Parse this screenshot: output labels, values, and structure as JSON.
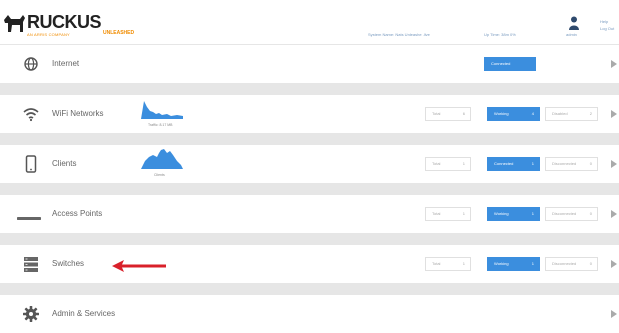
{
  "header": {
    "brand": "RUCKUS",
    "tagline": "AN ARRIS COMPANY",
    "product": "UNLEASHED",
    "system_name_label": "System Name: Nats Unleashe .llve",
    "up_time_label": "Up Time: 38m 0%",
    "user_label": "admin",
    "help_label": "Help",
    "logout_label": "Log Out",
    "icons": {
      "logo": "ruckus-dog-logo",
      "user": "user-icon"
    }
  },
  "colors": {
    "accent_blue": "#3b8ede",
    "brand_orange": "#f08c00",
    "annotation_red": "#d9202a"
  },
  "rows": {
    "internet": {
      "label": "Internet",
      "status": "Connected",
      "icon": "globe-icon"
    },
    "wifi": {
      "label": "WiFi Networks",
      "spark_label": "Traffic: 8.17 MB",
      "icon": "wifi-icon",
      "total_label": "Total",
      "total": "6",
      "working_label": "Working",
      "working": "4",
      "disabled_label": "Disabled",
      "disabled": "2"
    },
    "clients": {
      "label": "Clients",
      "spark_label": "Clients",
      "icon": "mobile-device-icon",
      "total_label": "Total",
      "total": "1",
      "connected_label": "Connected",
      "connected": "1",
      "disconnected_label": "Disconnected",
      "disconnected": "0"
    },
    "access_points": {
      "label": "Access Points",
      "icon": "access-point-icon",
      "total_label": "Total",
      "total": "1",
      "working_label": "Working",
      "working": "1",
      "disconnected_label": "Disconnected",
      "disconnected": "0"
    },
    "switches": {
      "label": "Switches",
      "icon": "switch-icon",
      "total_label": "Total",
      "total": "1",
      "working_label": "Working",
      "working": "1",
      "disconnected_label": "Disconnected",
      "disconnected": "0"
    },
    "admin": {
      "label": "Admin & Services",
      "icon": "gear-icon"
    }
  }
}
